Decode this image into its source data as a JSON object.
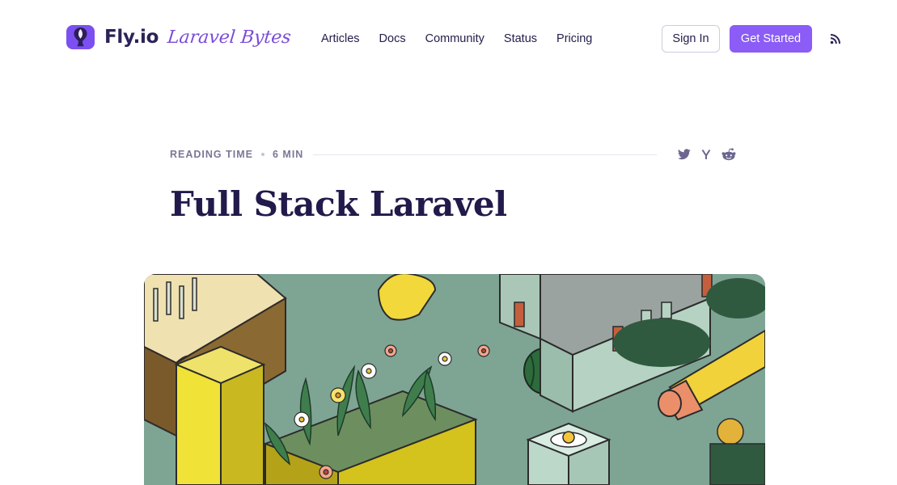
{
  "brand": {
    "name": "Fly.io",
    "subtitle": "Laravel Bytes",
    "accent": "#8b5cf6"
  },
  "nav": {
    "items": [
      "Articles",
      "Docs",
      "Community",
      "Status",
      "Pricing"
    ]
  },
  "header": {
    "sign_in": "Sign In",
    "get_started": "Get Started",
    "rss_icon": "rss-icon"
  },
  "meta": {
    "reading_label": "READING TIME",
    "reading_value": "6 MIN",
    "share_icons": [
      "twitter-icon",
      "hacker-news-icon",
      "reddit-icon"
    ]
  },
  "article": {
    "title": "Full Stack Laravel"
  },
  "hero": {
    "icon": "isometric-illustration"
  }
}
